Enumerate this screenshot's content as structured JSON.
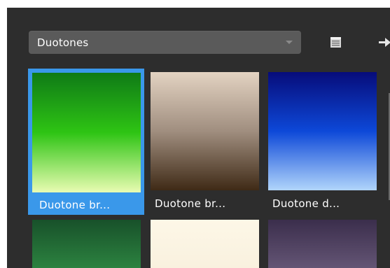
{
  "dropdown": {
    "selected": "Duotones"
  },
  "icons": {
    "list_view": "list-view-icon",
    "arrow": "arrow-right-icon"
  },
  "presets": [
    {
      "label": "Duotone br...",
      "selected": true,
      "gradient": [
        "#0f7a16",
        "#2ec414",
        "#e9fcb2"
      ]
    },
    {
      "label": "Duotone br...",
      "selected": false,
      "gradient": [
        "#e3d3c2",
        "#a08e7f",
        "#3f2a16"
      ]
    },
    {
      "label": "Duotone d...",
      "selected": false,
      "gradient": [
        "#070c7a",
        "#0d48d8",
        "#b1d5fb"
      ]
    },
    {
      "label": "",
      "selected": false,
      "gradient": [
        "#18512a",
        "#2f8a43"
      ]
    },
    {
      "label": "",
      "selected": false,
      "gradient": [
        "#fdf7e7",
        "#f8f0dd"
      ]
    },
    {
      "label": "",
      "selected": false,
      "gradient": [
        "#3b2e4c",
        "#6a5b7b"
      ]
    }
  ],
  "colors": {
    "panel_bg": "#2d2d2d",
    "dropdown_bg": "#5a5a5a",
    "selection": "#3a98ea"
  }
}
